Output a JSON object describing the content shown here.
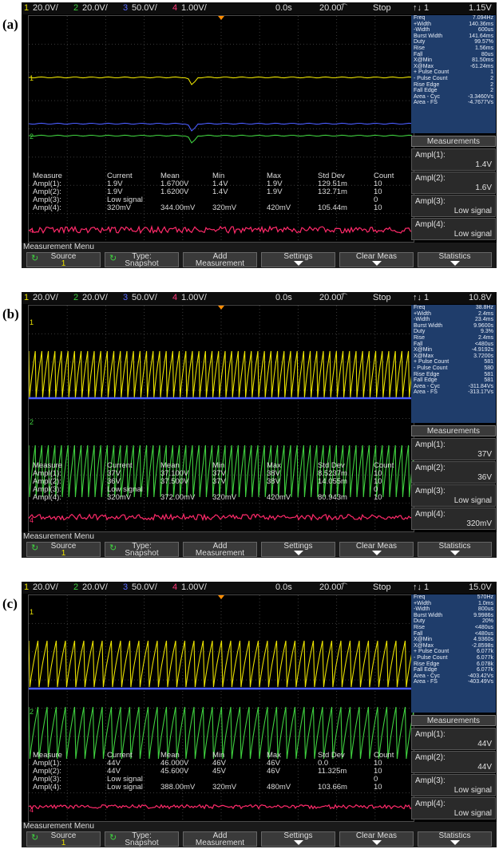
{
  "panels": [
    {
      "label": "(a)",
      "header": {
        "ch1": "1",
        "ch1_scale": "20.0V/",
        "ch2": "2",
        "ch2_scale": "20.0V/",
        "ch3": "3",
        "ch3_scale": "50.0V/",
        "ch4": "4",
        "ch4_scale": "1.00V/",
        "time_offset": "0.0s",
        "timebase": "20.00͡/",
        "run_state": "Stop",
        "trigger": "↑↓ 1",
        "trigger_level": "1.15V"
      },
      "info": [
        [
          "Freq",
          "7.094Hz"
        ],
        [
          "+Width",
          "140.36ms"
        ],
        [
          "-Width",
          "600us"
        ],
        [
          "Burst Width",
          "141.64ms"
        ],
        [
          "Duty",
          "99.57%"
        ],
        [
          "Rise",
          "1.56ms"
        ],
        [
          "Fall",
          "80us"
        ],
        [
          "X@Min",
          "81.50ms"
        ],
        [
          "X@Max",
          "-61.24ms"
        ],
        [
          "+ Pulse Count",
          "1"
        ],
        [
          "- Pulse Count",
          "2"
        ],
        [
          "Rise Edge",
          "2"
        ],
        [
          "Fall Edge",
          "2"
        ],
        [
          "Area - Cyc",
          "-3.3460Vs"
        ],
        [
          "Area - FS",
          "-4.7677Vs"
        ]
      ],
      "side_title": "Measurements",
      "side_items": [
        {
          "name": "Ampl(1):",
          "value": "1.4V"
        },
        {
          "name": "Ampl(2):",
          "value": "1.6V"
        },
        {
          "name": "Ampl(3):",
          "value": "Low signal"
        },
        {
          "name": "Ampl(4):",
          "value": "Low signal"
        }
      ],
      "table_header": [
        "Measure",
        "Current",
        "Mean",
        "Min",
        "Max",
        "Std Dev",
        "Count"
      ],
      "table_rows": [
        [
          "Ampl(1):",
          "1.9V",
          "1.6700V",
          "1.4V",
          "1.9V",
          "129.51m",
          "10"
        ],
        [
          "Ampl(2):",
          "1.9V",
          "1.6200V",
          "1.4V",
          "1.9V",
          "132.71m",
          "10"
        ],
        [
          "Ampl(3):",
          "Low signal",
          "",
          "",
          "",
          "",
          "0"
        ],
        [
          "Ampl(4):",
          "320mV",
          "344.00mV",
          "320mV",
          "420mV",
          "105.44m",
          "10"
        ]
      ],
      "menu": {
        "title": "Measurement Menu",
        "source_label": "Source",
        "source_value": "1",
        "type_label": "Type:",
        "type_value": "Snapshot",
        "add_label": "Add",
        "add_value": "Measurement",
        "settings": "Settings",
        "clear": "Clear Meas",
        "statistics": "Statistics"
      }
    },
    {
      "label": "(b)",
      "header": {
        "ch1": "1",
        "ch1_scale": "20.0V/",
        "ch2": "2",
        "ch2_scale": "20.0V/",
        "ch3": "3",
        "ch3_scale": "50.0V/",
        "ch4": "4",
        "ch4_scale": "1.00V/",
        "time_offset": "0.0s",
        "timebase": "20.00͡/",
        "run_state": "Stop",
        "trigger": "↑↓ 1",
        "trigger_level": "10.8V"
      },
      "info": [
        [
          "Freq",
          "38.8Hz"
        ],
        [
          "+Width",
          "2.4ms"
        ],
        [
          "-Width",
          "23.4ms"
        ],
        [
          "Burst Width",
          "9.9600s"
        ],
        [
          "Duty",
          "9.3%"
        ],
        [
          "Rise",
          "2.4ms"
        ],
        [
          "Fall",
          "<480us"
        ],
        [
          "X@Min",
          "-4.9192s"
        ],
        [
          "X@Max",
          "3.7200s"
        ],
        [
          "+ Pulse Count",
          "581"
        ],
        [
          "- Pulse Count",
          "580"
        ],
        [
          "Rise Edge",
          "581"
        ],
        [
          "Fall Edge",
          "581"
        ],
        [
          "Area - Cyc",
          "-311.84Vs"
        ],
        [
          "Area - FS",
          "-313.17Vs"
        ]
      ],
      "side_title": "Measurements",
      "side_items": [
        {
          "name": "Ampl(1):",
          "value": "37V"
        },
        {
          "name": "Ampl(2):",
          "value": "36V"
        },
        {
          "name": "Ampl(3):",
          "value": "Low signal"
        },
        {
          "name": "Ampl(4):",
          "value": "320mV"
        }
      ],
      "table_header": [
        "Measure",
        "Current",
        "Mean",
        "Min",
        "Max",
        "Std Dev",
        "Count"
      ],
      "table_rows": [
        [
          "Ampl(1):",
          "37V",
          "37.100V",
          "37V",
          "38V",
          "8.5237m",
          "10"
        ],
        [
          "Ampl(2):",
          "36V",
          "37.500V",
          "37V",
          "38V",
          "14.055m",
          "10"
        ],
        [
          "Ampl(3):",
          "Low signal",
          "",
          "",
          "",
          "",
          "0"
        ],
        [
          "Ampl(4):",
          "320mV",
          "372.00mV",
          "320mV",
          "420mV",
          "80.943m",
          "10"
        ]
      ],
      "menu": {
        "title": "Measurement Menu",
        "source_label": "Source",
        "source_value": "1",
        "type_label": "Type:",
        "type_value": "Snapshot",
        "add_label": "Add",
        "add_value": "Measurement",
        "settings": "Settings",
        "clear": "Clear Meas",
        "statistics": "Statistics"
      }
    },
    {
      "label": "(c)",
      "header": {
        "ch1": "1",
        "ch1_scale": "20.0V/",
        "ch2": "2",
        "ch2_scale": "20.0V/",
        "ch3": "3",
        "ch3_scale": "50.0V/",
        "ch4": "4",
        "ch4_scale": "1.00V/",
        "time_offset": "0.0s",
        "timebase": "20.00͡/",
        "run_state": "Stop",
        "trigger": "↑↓ 1",
        "trigger_level": "15.0V"
      },
      "info": [
        [
          "Freq",
          "570Hz"
        ],
        [
          "+Width",
          "1.0ms"
        ],
        [
          "-Width",
          "800us"
        ],
        [
          "Burst Width",
          "9.9986s"
        ],
        [
          "Duty",
          "20%"
        ],
        [
          "Rise",
          "<480us"
        ],
        [
          "Fall",
          "<480us"
        ],
        [
          "X@Min",
          "4.9360s"
        ],
        [
          "X@Max",
          "-2.8598s"
        ],
        [
          "+ Pulse Count",
          "6.077k"
        ],
        [
          "- Pulse Count",
          "6.077k"
        ],
        [
          "Rise Edge",
          "6.078k"
        ],
        [
          "Fall Edge",
          "6.077k"
        ],
        [
          "Area - Cyc",
          "-403.42Vs"
        ],
        [
          "Area - FS",
          "-403.49Vs"
        ]
      ],
      "side_title": "Measurements",
      "side_items": [
        {
          "name": "Ampl(1):",
          "value": "44V"
        },
        {
          "name": "Ampl(2):",
          "value": "44V"
        },
        {
          "name": "Ampl(3):",
          "value": "Low signal"
        },
        {
          "name": "Ampl(4):",
          "value": "Low signal"
        }
      ],
      "table_header": [
        "Measure",
        "Current",
        "Mean",
        "Min",
        "Max",
        "Std Dev",
        "Count"
      ],
      "table_rows": [
        [
          "Ampl(1):",
          "44V",
          "46.000V",
          "46V",
          "46V",
          "0.0",
          "10"
        ],
        [
          "Ampl(2):",
          "44V",
          "45.600V",
          "45V",
          "46V",
          "11.325m",
          "10"
        ],
        [
          "Ampl(3):",
          "Low signal",
          "",
          "",
          "",
          "",
          "0"
        ],
        [
          "Ampl(4):",
          "Low signal",
          "388.00mV",
          "320mV",
          "480mV",
          "103.66m",
          "10"
        ]
      ],
      "menu": {
        "title": "Measurement Menu",
        "source_label": "Source",
        "source_value": "1",
        "type_label": "Type:",
        "type_value": "Snapshot",
        "add_label": "Add",
        "add_value": "Measurement",
        "settings": "Settings",
        "clear": "Clear Meas",
        "statistics": "Statistics"
      }
    }
  ],
  "colors": {
    "ch1": "#e8e000",
    "ch2": "#3fd03f",
    "ch3": "#4a5cff",
    "ch4": "#ff2a6a",
    "grid": "#3a3a3a",
    "info_bg": "#1f3d6b"
  },
  "trace_styles": [
    "flat-dip",
    "sawtooth-dense",
    "sawtooth-dense"
  ]
}
